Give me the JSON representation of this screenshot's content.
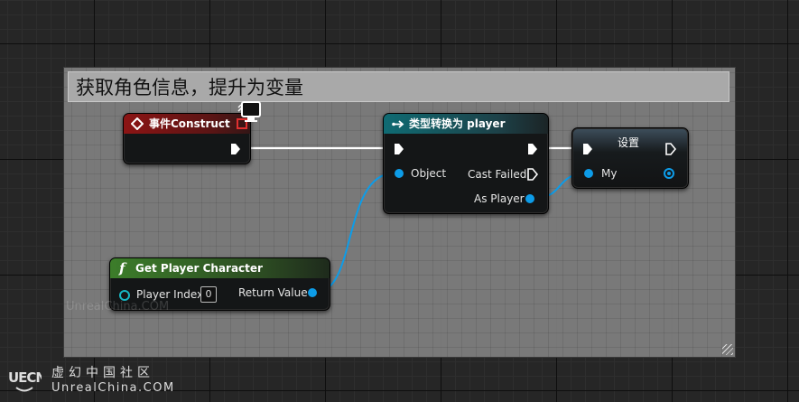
{
  "comment": {
    "title": "获取角色信息，提升为变量"
  },
  "nodes": {
    "event_construct": {
      "title": "事件Construct"
    },
    "cast": {
      "title": "类型转换为 player",
      "pin_object": "Object",
      "pin_cast_failed": "Cast Failed",
      "pin_as_player": "As Player"
    },
    "set": {
      "title": "设置",
      "pin_my": "My"
    },
    "get_player_character": {
      "title": "Get Player Character",
      "pin_player_index": "Player Index",
      "player_index_value": "0",
      "pin_return_value": "Return Value"
    }
  },
  "watermark": "UnrealChina.COM",
  "logo": {
    "mark": "UECN",
    "chinese": "虚幻中国社区",
    "english": "UnrealChina.COM"
  },
  "colors": {
    "exec_wire": "#ffffff",
    "object_wire": "#0d9ce8",
    "event_header": "#8c1414",
    "cast_header": "#0f6b73",
    "function_header": "#3c7d2a"
  },
  "icons": [
    "event-diamond-icon",
    "exec-arrow-icon",
    "function-icon",
    "delegate-pin-icon",
    "client-monitor-icon",
    "resize-grip-icon"
  ]
}
